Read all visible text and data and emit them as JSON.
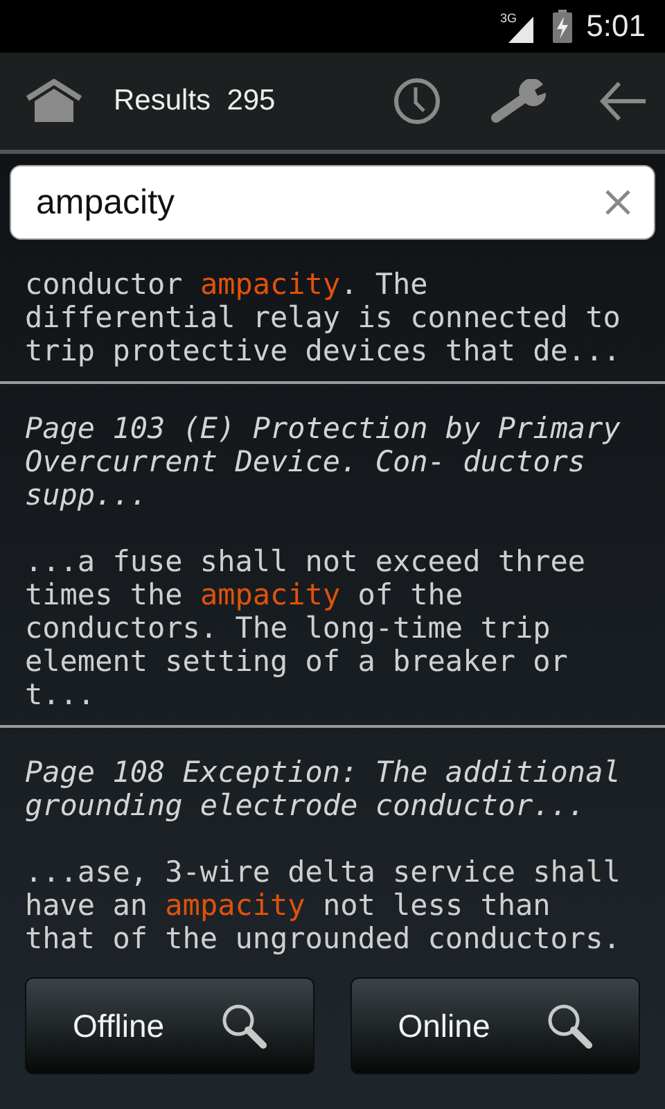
{
  "status_bar": {
    "network": "3G",
    "time": "5:01"
  },
  "action_bar": {
    "title": "Results",
    "count": "295"
  },
  "search": {
    "value": "ampacity"
  },
  "results": [
    {
      "snippet": [
        {
          "text": "conductor "
        },
        {
          "text": "ampacity",
          "highlighted": true
        },
        {
          "text": ". The differential relay is connected to trip protective devices that de..."
        }
      ]
    },
    {
      "title": "Page 103 (E) Protection by Primary Overcurrent Device. Con- ductors supp...",
      "snippet": [
        {
          "text": "...a fuse shall not exceed three times the "
        },
        {
          "text": "ampacity",
          "highlighted": true
        },
        {
          "text": " of the conductors. The long-time trip element setting of a breaker or t..."
        }
      ]
    },
    {
      "title": "Page 108 Exception: The additional grounding electrode conductor...",
      "snippet": [
        {
          "text": "...ase, 3-wire delta service shall have an "
        },
        {
          "text": "ampacity",
          "highlighted": true
        },
        {
          "text": " not less than that of the ungrounded conductors."
        }
      ]
    }
  ],
  "buttons": [
    {
      "label": "Offline"
    },
    {
      "label": "Online"
    }
  ]
}
